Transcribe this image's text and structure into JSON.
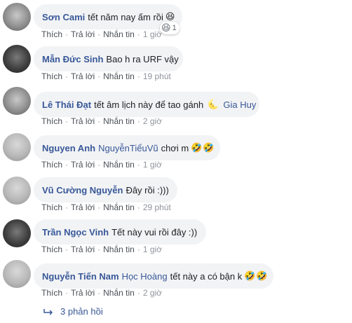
{
  "comments": [
    {
      "author": "Sơn Cami",
      "mention": "",
      "text": "tết năm nay ấm rồi",
      "emoji": "😆",
      "emoji2": "",
      "like": "Thích",
      "reply": "Trả lời",
      "message": "Nhắn tin",
      "time": "1 giờ",
      "reactions": {
        "icon": "😆",
        "count": "1"
      }
    },
    {
      "author": "Mẫn Đức Sinh",
      "mention": "",
      "text": "Bao h ra URF vậy",
      "emoji": "",
      "emoji2": "",
      "like": "Thích",
      "reply": "Trả lời",
      "message": "Nhắn tin",
      "time": "19 phút"
    },
    {
      "author": "Lê Thái Đạt",
      "mention": "",
      "text": "tết âm lịch này để tao gánh",
      "emoji": "🌜",
      "emoji2": "",
      "tail_mention": "Gia Huy",
      "like": "Thích",
      "reply": "Trả lời",
      "message": "Nhắn tin",
      "time": "2 giờ"
    },
    {
      "author": "Nguyen Anh",
      "mention": "NguyễnTiểuVũ",
      "text": "chơi m",
      "emoji": "🤣",
      "emoji2": "🤣",
      "like": "Thích",
      "reply": "Trả lời",
      "message": "Nhắn tin",
      "time": "1 giờ"
    },
    {
      "author": "Vũ Cường Nguyễn",
      "mention": "",
      "text": "Đây rồi :)))",
      "emoji": "",
      "emoji2": "",
      "like": "Thích",
      "reply": "Trả lời",
      "message": "Nhắn tin",
      "time": "29 phút"
    },
    {
      "author": "Trần Ngọc Vinh",
      "mention": "",
      "text": "Tết này vui rồi đây :))",
      "emoji": "",
      "emoji2": "",
      "like": "Thích",
      "reply": "Trả lời",
      "message": "Nhắn tin",
      "time": "1 giờ"
    },
    {
      "author": "Nguyễn Tiến Nam",
      "mention": "Học Hoàng",
      "text": "tết này a có bận k",
      "emoji": "🤣",
      "emoji2": "🤣",
      "like": "Thích",
      "reply": "Trả lời",
      "message": "Nhắn tin",
      "time": "2 giờ"
    }
  ],
  "replies_link": "3 phản hồi",
  "colors": {
    "link": "#385898",
    "bubble": "#f2f3f5",
    "meta": "#90949c"
  }
}
